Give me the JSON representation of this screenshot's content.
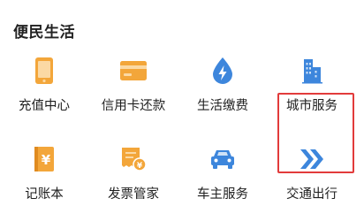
{
  "section": {
    "title": "便民生活"
  },
  "colors": {
    "orange": "#f3a63a",
    "blue": "#3d86dc",
    "highlight": "#e23b3b"
  },
  "items": [
    {
      "label": "充值中心",
      "icon": "phone-icon",
      "highlighted": false
    },
    {
      "label": "信用卡还款",
      "icon": "credit-card-icon",
      "highlighted": false
    },
    {
      "label": "生活缴费",
      "icon": "lightning-drop-icon",
      "highlighted": false
    },
    {
      "label": "城市服务",
      "icon": "city-buildings-icon",
      "highlighted": true
    },
    {
      "label": "记账本",
      "icon": "ledger-yuan-icon",
      "highlighted": false
    },
    {
      "label": "发票管家",
      "icon": "invoice-icon",
      "highlighted": false
    },
    {
      "label": "车主服务",
      "icon": "car-icon",
      "highlighted": false
    },
    {
      "label": "交通出行",
      "icon": "double-arrow-icon",
      "highlighted": false
    }
  ]
}
